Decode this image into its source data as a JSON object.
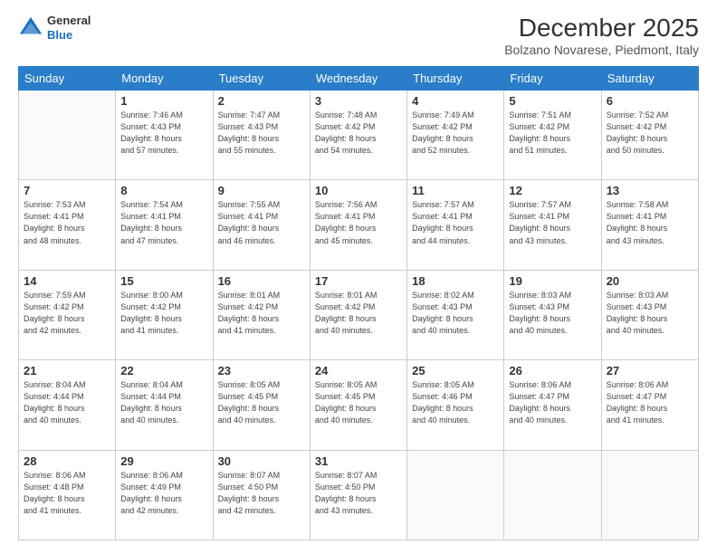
{
  "header": {
    "logo_general": "General",
    "logo_blue": "Blue",
    "month_title": "December 2025",
    "location": "Bolzano Novarese, Piedmont, Italy"
  },
  "days_of_week": [
    "Sunday",
    "Monday",
    "Tuesday",
    "Wednesday",
    "Thursday",
    "Friday",
    "Saturday"
  ],
  "weeks": [
    [
      {
        "day": "",
        "info": ""
      },
      {
        "day": "1",
        "info": "Sunrise: 7:46 AM\nSunset: 4:43 PM\nDaylight: 8 hours\nand 57 minutes."
      },
      {
        "day": "2",
        "info": "Sunrise: 7:47 AM\nSunset: 4:43 PM\nDaylight: 8 hours\nand 55 minutes."
      },
      {
        "day": "3",
        "info": "Sunrise: 7:48 AM\nSunset: 4:42 PM\nDaylight: 8 hours\nand 54 minutes."
      },
      {
        "day": "4",
        "info": "Sunrise: 7:49 AM\nSunset: 4:42 PM\nDaylight: 8 hours\nand 52 minutes."
      },
      {
        "day": "5",
        "info": "Sunrise: 7:51 AM\nSunset: 4:42 PM\nDaylight: 8 hours\nand 51 minutes."
      },
      {
        "day": "6",
        "info": "Sunrise: 7:52 AM\nSunset: 4:42 PM\nDaylight: 8 hours\nand 50 minutes."
      }
    ],
    [
      {
        "day": "7",
        "info": "Sunrise: 7:53 AM\nSunset: 4:41 PM\nDaylight: 8 hours\nand 48 minutes."
      },
      {
        "day": "8",
        "info": "Sunrise: 7:54 AM\nSunset: 4:41 PM\nDaylight: 8 hours\nand 47 minutes."
      },
      {
        "day": "9",
        "info": "Sunrise: 7:55 AM\nSunset: 4:41 PM\nDaylight: 8 hours\nand 46 minutes."
      },
      {
        "day": "10",
        "info": "Sunrise: 7:56 AM\nSunset: 4:41 PM\nDaylight: 8 hours\nand 45 minutes."
      },
      {
        "day": "11",
        "info": "Sunrise: 7:57 AM\nSunset: 4:41 PM\nDaylight: 8 hours\nand 44 minutes."
      },
      {
        "day": "12",
        "info": "Sunrise: 7:57 AM\nSunset: 4:41 PM\nDaylight: 8 hours\nand 43 minutes."
      },
      {
        "day": "13",
        "info": "Sunrise: 7:58 AM\nSunset: 4:41 PM\nDaylight: 8 hours\nand 43 minutes."
      }
    ],
    [
      {
        "day": "14",
        "info": "Sunrise: 7:59 AM\nSunset: 4:42 PM\nDaylight: 8 hours\nand 42 minutes."
      },
      {
        "day": "15",
        "info": "Sunrise: 8:00 AM\nSunset: 4:42 PM\nDaylight: 8 hours\nand 41 minutes."
      },
      {
        "day": "16",
        "info": "Sunrise: 8:01 AM\nSunset: 4:42 PM\nDaylight: 8 hours\nand 41 minutes."
      },
      {
        "day": "17",
        "info": "Sunrise: 8:01 AM\nSunset: 4:42 PM\nDaylight: 8 hours\nand 40 minutes."
      },
      {
        "day": "18",
        "info": "Sunrise: 8:02 AM\nSunset: 4:43 PM\nDaylight: 8 hours\nand 40 minutes."
      },
      {
        "day": "19",
        "info": "Sunrise: 8:03 AM\nSunset: 4:43 PM\nDaylight: 8 hours\nand 40 minutes."
      },
      {
        "day": "20",
        "info": "Sunrise: 8:03 AM\nSunset: 4:43 PM\nDaylight: 8 hours\nand 40 minutes."
      }
    ],
    [
      {
        "day": "21",
        "info": "Sunrise: 8:04 AM\nSunset: 4:44 PM\nDaylight: 8 hours\nand 40 minutes."
      },
      {
        "day": "22",
        "info": "Sunrise: 8:04 AM\nSunset: 4:44 PM\nDaylight: 8 hours\nand 40 minutes."
      },
      {
        "day": "23",
        "info": "Sunrise: 8:05 AM\nSunset: 4:45 PM\nDaylight: 8 hours\nand 40 minutes."
      },
      {
        "day": "24",
        "info": "Sunrise: 8:05 AM\nSunset: 4:45 PM\nDaylight: 8 hours\nand 40 minutes."
      },
      {
        "day": "25",
        "info": "Sunrise: 8:05 AM\nSunset: 4:46 PM\nDaylight: 8 hours\nand 40 minutes."
      },
      {
        "day": "26",
        "info": "Sunrise: 8:06 AM\nSunset: 4:47 PM\nDaylight: 8 hours\nand 40 minutes."
      },
      {
        "day": "27",
        "info": "Sunrise: 8:06 AM\nSunset: 4:47 PM\nDaylight: 8 hours\nand 41 minutes."
      }
    ],
    [
      {
        "day": "28",
        "info": "Sunrise: 8:06 AM\nSunset: 4:48 PM\nDaylight: 8 hours\nand 41 minutes."
      },
      {
        "day": "29",
        "info": "Sunrise: 8:06 AM\nSunset: 4:49 PM\nDaylight: 8 hours\nand 42 minutes."
      },
      {
        "day": "30",
        "info": "Sunrise: 8:07 AM\nSunset: 4:50 PM\nDaylight: 8 hours\nand 42 minutes."
      },
      {
        "day": "31",
        "info": "Sunrise: 8:07 AM\nSunset: 4:50 PM\nDaylight: 8 hours\nand 43 minutes."
      },
      {
        "day": "",
        "info": ""
      },
      {
        "day": "",
        "info": ""
      },
      {
        "day": "",
        "info": ""
      }
    ]
  ]
}
